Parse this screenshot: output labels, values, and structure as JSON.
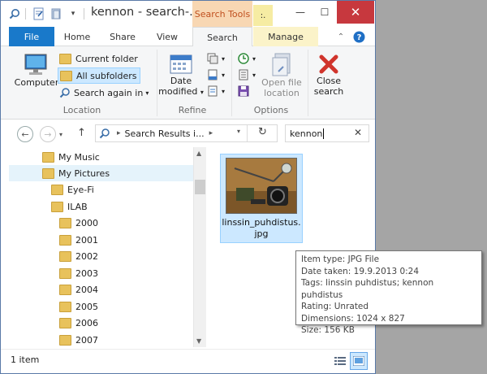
{
  "window": {
    "title": "kennon - search-...",
    "contextual_tab": "Search Tools",
    "yellow_tab_text": ":.",
    "controls": {
      "minimize": "—",
      "maximize": "☐",
      "close": "✕"
    }
  },
  "ribbon_tabs": [
    "File",
    "Home",
    "Share",
    "View",
    "Search",
    "Manage"
  ],
  "ribbon": {
    "location": {
      "computer": "Computer",
      "current_folder": "Current folder",
      "all_subfolders": "All subfolders",
      "search_again_in": "Search again in",
      "group_label": "Location"
    },
    "refine": {
      "date_modified_line1": "Date",
      "date_modified_line2": "modified",
      "group_label": "Refine"
    },
    "options": {
      "open_file_location_line1": "Open file",
      "open_file_location_line2": "location",
      "group_label": "Options"
    },
    "close_search": {
      "line1": "Close",
      "line2": "search"
    }
  },
  "address": {
    "path": "Search Results i...",
    "search_value": "kennon"
  },
  "nav_items": [
    {
      "label": "My Music"
    },
    {
      "label": "My Pictures"
    },
    {
      "label": "Eye-Fi"
    },
    {
      "label": "ILAB"
    },
    {
      "label": "2000"
    },
    {
      "label": "2001"
    },
    {
      "label": "2002"
    },
    {
      "label": "2003"
    },
    {
      "label": "2004"
    },
    {
      "label": "2005"
    },
    {
      "label": "2006"
    },
    {
      "label": "2007"
    }
  ],
  "file": {
    "name_line1": "linssin_puhdistus.",
    "name_line2": "jpg"
  },
  "tooltip": {
    "item_type": "Item type: JPG File",
    "date_taken": "Date taken: 19.9.2013 0:24",
    "tags": "Tags: linssin puhdistus; kennon puhdistus",
    "rating": "Rating: Unrated",
    "dimensions": "Dimensions: 1024 x 827",
    "size": "Size: 156 KB"
  },
  "status": {
    "item_count": "1 item"
  },
  "colors": {
    "file_tab": "#1979ca",
    "search_tools": "#f8d7b3",
    "close_red": "#c7383e",
    "selection": "#cce8ff"
  }
}
